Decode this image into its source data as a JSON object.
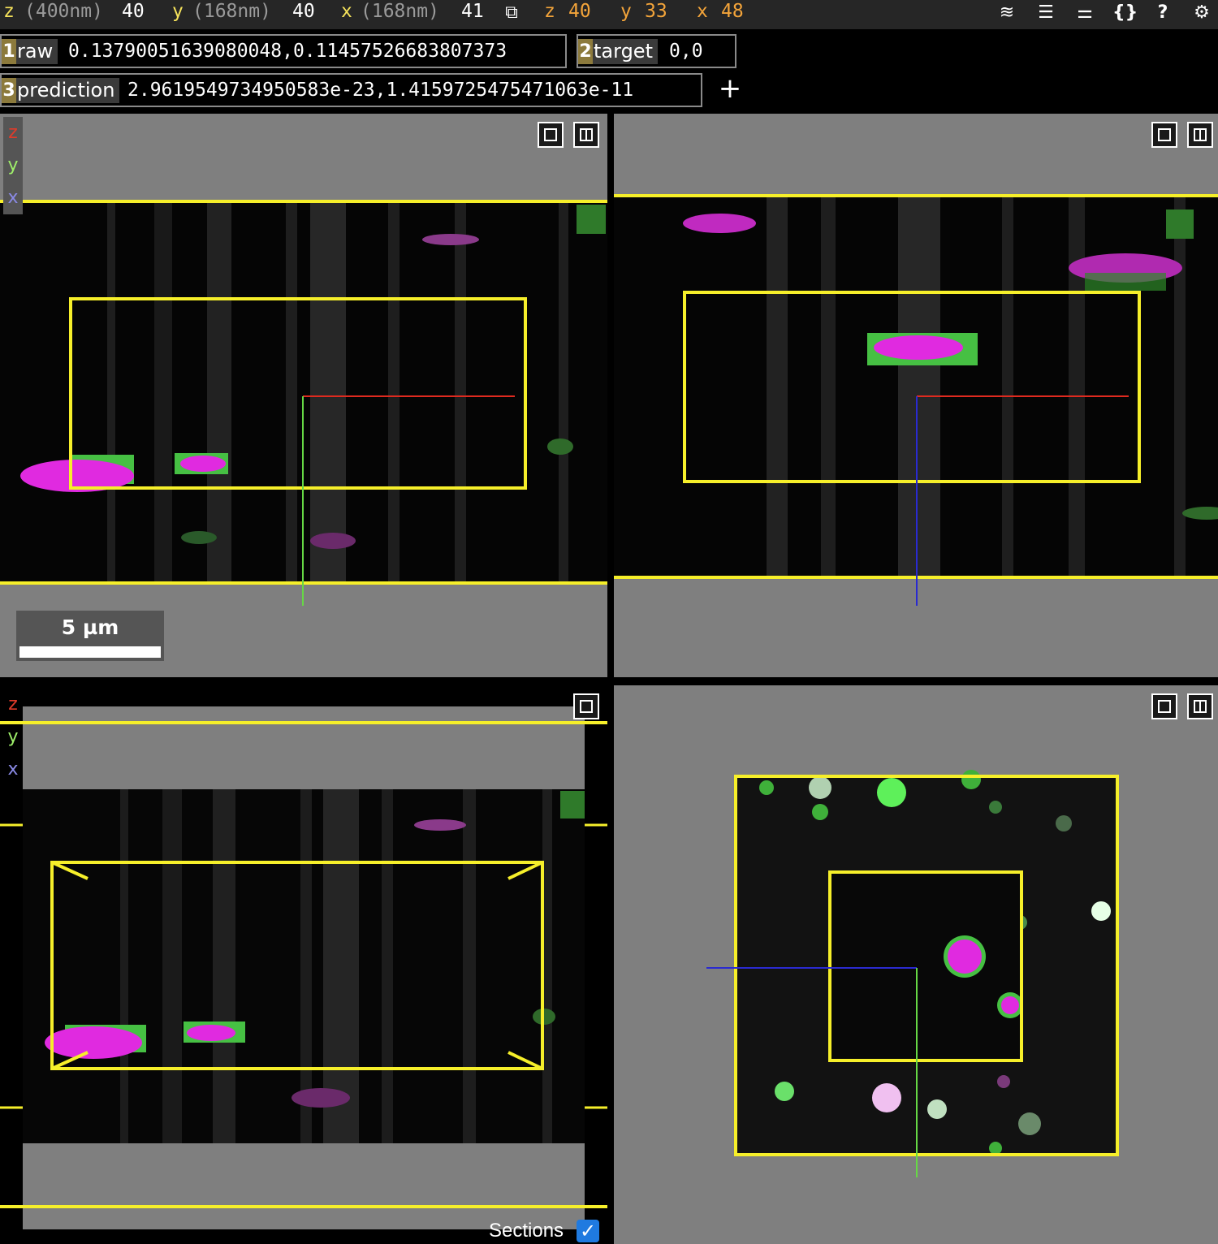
{
  "status_bar": {
    "z_label": "z",
    "z_unit": "(400nm)",
    "z_value": "40",
    "y_label": "y",
    "y_unit": "(168nm)",
    "y_value": "40",
    "x_label": "x",
    "x_unit": "(168nm)",
    "x_value": "41",
    "mouse_z_label": "z",
    "mouse_z_value": "40",
    "mouse_y_label": "y",
    "mouse_y_value": "33",
    "mouse_x_label": "x",
    "mouse_x_value": "48"
  },
  "toolbar_icons": [
    "copy-icon",
    "layers-icon",
    "list-icon",
    "sliders-icon",
    "braces-icon",
    "help-icon",
    "settings-icon"
  ],
  "toolbar_symbols": {
    "braces": "{}",
    "help": "?",
    "settings": "⚙",
    "copy": "⧉",
    "layers": "≋",
    "list": "☰",
    "sliders": "⚌"
  },
  "layers": [
    {
      "number": "1",
      "name": "raw",
      "value": "0.13790051639080048,0.11457526683807373"
    },
    {
      "number": "2",
      "name": "target",
      "value": "0,0"
    },
    {
      "number": "3",
      "name": "prediction",
      "value": "2.9619549734950583e-23,1.4159725475471063e-11"
    }
  ],
  "add_layer_label": "+",
  "axes_labels": {
    "z": "z",
    "y": "y",
    "x": "x"
  },
  "scale_bar": {
    "label": "5 µm"
  },
  "sections": {
    "label": "Sections",
    "checked": true,
    "check_glyph": "✓"
  },
  "colors": {
    "bounding_box": "#f6ef2a",
    "cross_red": "#e02a1f",
    "cross_green": "#66d845",
    "cross_blue": "#2a2ad0",
    "magenta": "#e62ae6",
    "green_channel": "#3fb03a",
    "background_gray": "#7f7f7f"
  }
}
